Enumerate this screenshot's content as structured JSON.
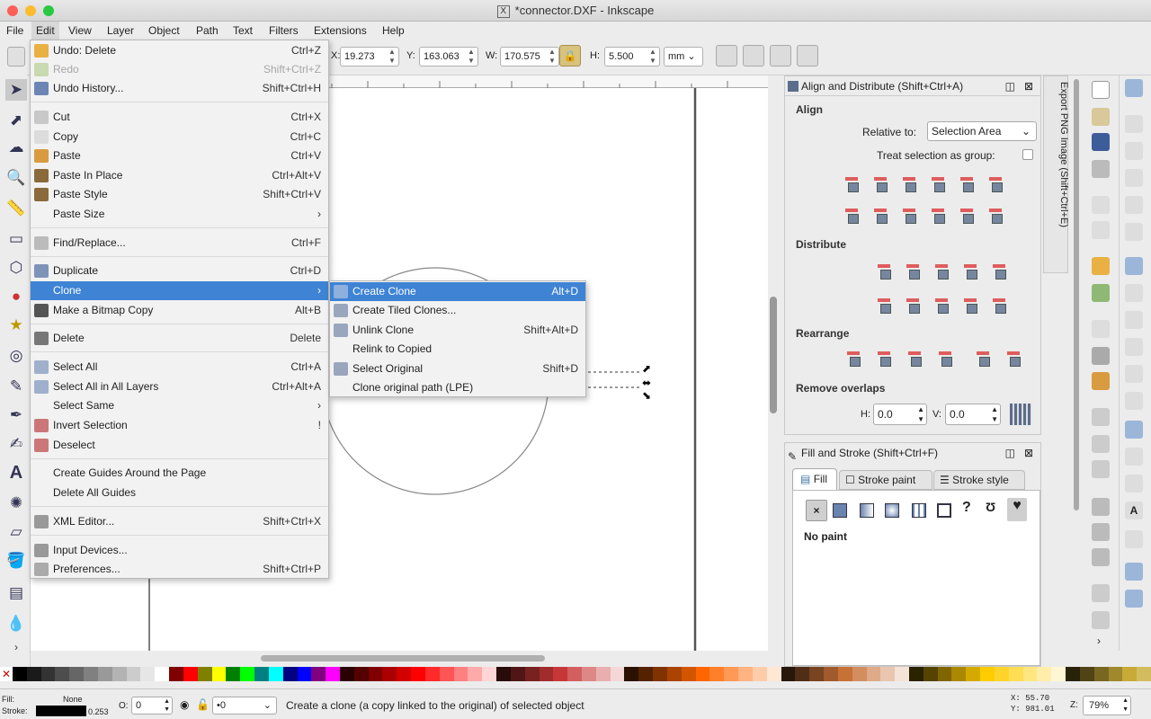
{
  "window_title": "*connector.DXF - Inkscape",
  "menubar": [
    "File",
    "Edit",
    "View",
    "Layer",
    "Object",
    "Path",
    "Text",
    "Filters",
    "Extensions",
    "Help"
  ],
  "controls": {
    "x_label": "X:",
    "x_value": "19.273",
    "y_label": "Y:",
    "y_value": "163.063",
    "w_label": "W:",
    "w_value": "170.575",
    "h_label": "H:",
    "h_value": "5.500",
    "unit": "mm"
  },
  "edit_menu": [
    {
      "label": "Undo: Delete",
      "shortcut": "Ctrl+Z",
      "icon": "undo-icon"
    },
    {
      "label": "Redo",
      "shortcut": "Shift+Ctrl+Z",
      "icon": "redo-icon",
      "disabled": true
    },
    {
      "label": "Undo History...",
      "shortcut": "Shift+Ctrl+H",
      "icon": "history-icon"
    },
    {
      "label": "Cut",
      "shortcut": "Ctrl+X",
      "icon": "cut-icon"
    },
    {
      "label": "Copy",
      "shortcut": "Ctrl+C",
      "icon": "copy-icon"
    },
    {
      "label": "Paste",
      "shortcut": "Ctrl+V",
      "icon": "paste-icon"
    },
    {
      "label": "Paste In Place",
      "shortcut": "Ctrl+Alt+V",
      "icon": "paste-in-place-icon"
    },
    {
      "label": "Paste Style",
      "shortcut": "Shift+Ctrl+V",
      "icon": "paste-style-icon"
    },
    {
      "label": "Paste Size",
      "shortcut": "›",
      "icon": ""
    },
    {
      "label": "Find/Replace...",
      "shortcut": "Ctrl+F",
      "icon": "find-icon"
    },
    {
      "label": "Duplicate",
      "shortcut": "Ctrl+D",
      "icon": "duplicate-icon"
    },
    {
      "label": "Clone",
      "shortcut": "›",
      "icon": ""
    },
    {
      "label": "Make a Bitmap Copy",
      "shortcut": "Alt+B",
      "icon": "bitmap-icon"
    },
    {
      "label": "Delete",
      "shortcut": "Delete",
      "icon": "delete-icon"
    },
    {
      "label": "Select All",
      "shortcut": "Ctrl+A",
      "icon": "select-all-icon"
    },
    {
      "label": "Select All in All Layers",
      "shortcut": "Ctrl+Alt+A",
      "icon": "select-all-layers-icon"
    },
    {
      "label": "Select Same",
      "shortcut": "›",
      "icon": ""
    },
    {
      "label": "Invert Selection",
      "shortcut": "!",
      "icon": "invert-selection-icon"
    },
    {
      "label": "Deselect",
      "shortcut": "",
      "icon": "deselect-icon"
    },
    {
      "label": "Create Guides Around the Page",
      "shortcut": "",
      "icon": ""
    },
    {
      "label": "Delete All Guides",
      "shortcut": "",
      "icon": ""
    },
    {
      "label": "XML Editor...",
      "shortcut": "Shift+Ctrl+X",
      "icon": "xml-editor-icon"
    },
    {
      "label": "Input Devices...",
      "shortcut": "",
      "icon": "input-devices-icon"
    },
    {
      "label": "Preferences...",
      "shortcut": "Shift+Ctrl+P",
      "icon": "preferences-icon"
    }
  ],
  "clone_submenu": [
    {
      "label": "Create Clone",
      "shortcut": "Alt+D",
      "icon": "create-clone-icon"
    },
    {
      "label": "Create Tiled Clones...",
      "shortcut": "",
      "icon": "tiled-clones-icon"
    },
    {
      "label": "Unlink Clone",
      "shortcut": "Shift+Alt+D",
      "icon": "unlink-clone-icon"
    },
    {
      "label": "Relink to Copied",
      "shortcut": "",
      "icon": ""
    },
    {
      "label": "Select Original",
      "shortcut": "Shift+D",
      "icon": "select-original-icon"
    },
    {
      "label": "Clone original path (LPE)",
      "shortcut": "",
      "icon": ""
    }
  ],
  "align_panel": {
    "title": "Align and Distribute (Shift+Ctrl+A)",
    "align": "Align",
    "relative_label": "Relative to:",
    "relative_value": "Selection Area",
    "treat_group": "Treat selection as group:",
    "distribute": "Distribute",
    "rearrange": "Rearrange",
    "remove_overlaps": "Remove overlaps",
    "h_label": "H:",
    "h_value": "0.0",
    "v_label": "V:",
    "v_value": "0.0",
    "side_tab": "Export PNG Image (Shift+Ctrl+E)"
  },
  "fill_panel": {
    "title": "Fill and Stroke (Shift+Ctrl+F)",
    "tabs": [
      "Fill",
      "Stroke paint",
      "Stroke style"
    ],
    "no_paint": "No paint"
  },
  "status": {
    "fill_label": "Fill:",
    "fill_value": "None",
    "stroke_label": "Stroke:",
    "stroke_width": "0.253",
    "opacity_label": "O:",
    "opacity_value": "0",
    "layer_value": "•0",
    "message": "Create a clone (a copy linked to the original) of selected object",
    "x_coord": "X:  55.70",
    "y_coord": "Y:  981.01",
    "zoom_label": "Z:",
    "zoom_value": "79%"
  }
}
